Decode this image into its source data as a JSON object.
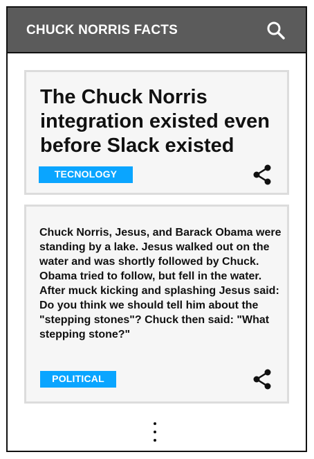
{
  "app": {
    "title": "CHUCK NORRIS FACTS",
    "search_icon": "search-icon"
  },
  "facts": [
    {
      "text": "The Chuck Norris integration existed even before Slack existed",
      "category": "TECNOLOGY",
      "share_icon": "share-icon"
    },
    {
      "text": "Chuck Norris, Jesus, and Barack Obama were standing by a lake. Jesus walked out on the water and was shortly followed by Chuck. Obama tried to follow, but fell in the water. After muck kicking and splashing Jesus said: Do you think we should tell him about the \"stepping stones\"? Chuck then said: \"What stepping stone?\"",
      "category": "POLITICAL",
      "share_icon": "share-icon"
    }
  ],
  "more_icon": "more-vert-icon",
  "colors": {
    "appbar": "#5b5b5b",
    "tag": "#0aa5ff",
    "card_bg": "#f6f6f6",
    "card_border": "#dcdcdc"
  }
}
